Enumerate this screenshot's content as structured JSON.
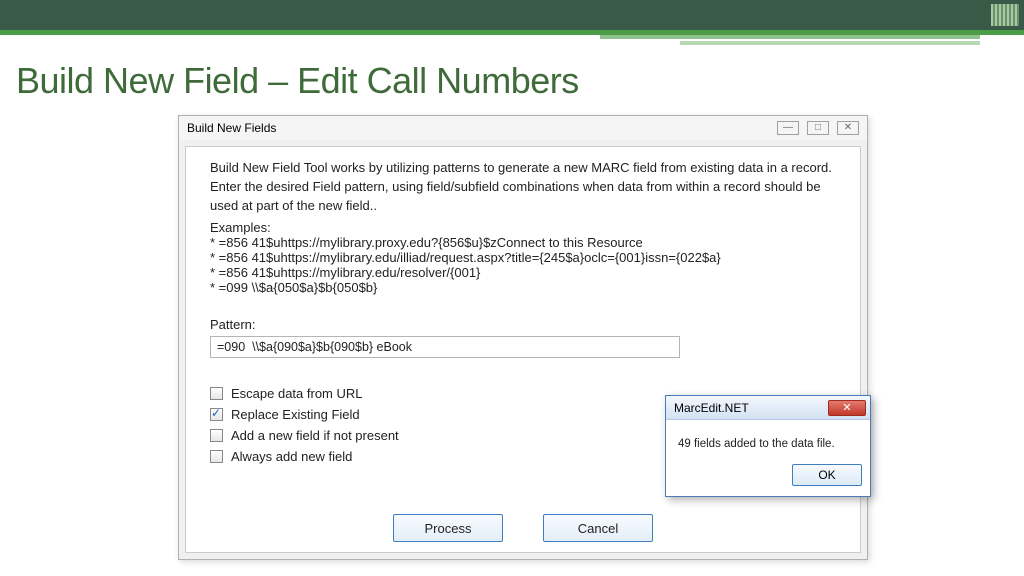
{
  "slide": {
    "title": "Build New Field – Edit Call Numbers"
  },
  "window": {
    "title": "Build New Fields",
    "chrome": {
      "min": "—",
      "max": "□",
      "close": "✕"
    },
    "description": "Build New Field Tool works by utilizing patterns to generate a new MARC field from existing data in a record.  Enter the desired Field pattern, using field/subfield combinations when data from within a record should be used at part of the new field..",
    "examples_label": "Examples:",
    "examples": [
      "* =856  41$uhttps://mylibrary.proxy.edu?{856$u}$zConnect to this Resource",
      "* =856  41$uhttps://mylibrary.edu/illiad/request.aspx?title={245$a}oclc={001}issn={022$a}",
      "* =856  41$uhttps://mylibrary.edu/resolver/{001}",
      "* =099  \\\\$a{050$a}$b{050$b}"
    ],
    "pattern_label": "Pattern:",
    "pattern_value": "=090  \\\\$a{090$a}$b{090$b} eBook",
    "checks": [
      {
        "label": "Escape data from URL",
        "checked": false
      },
      {
        "label": "Replace Existing Field",
        "checked": true
      },
      {
        "label": "Add a new field if not present",
        "checked": false
      },
      {
        "label": "Always add new field",
        "checked": false
      }
    ],
    "process_btn": "Process",
    "cancel_btn": "Cancel"
  },
  "msgbox": {
    "title": "MarcEdit.NET",
    "body": "49 fields added to the data file.",
    "ok": "OK"
  }
}
